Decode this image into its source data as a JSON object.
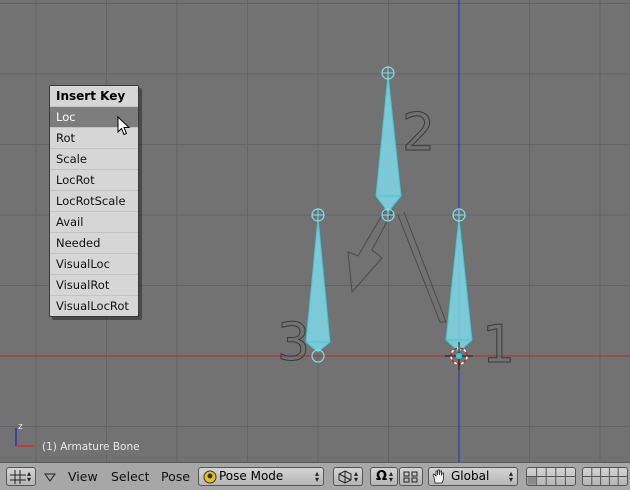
{
  "menu": {
    "title": "Insert Key",
    "items": [
      "Loc",
      "Rot",
      "Scale",
      "LocRot",
      "LocRotScale",
      "Avail",
      "Needed",
      "VisualLoc",
      "VisualRot",
      "VisualLocRot"
    ],
    "active_index": 0
  },
  "viewport": {
    "status": "(1) Armature Bone",
    "axis_label": "z",
    "bone_labels": [
      "1",
      "2",
      "3"
    ]
  },
  "header": {
    "menus": [
      "View",
      "Select",
      "Pose"
    ],
    "mode": "Pose Mode",
    "orientation": "Global"
  },
  "colors": {
    "viewport_bg": "#727272",
    "grid_line": "#646464",
    "bone_fill": "#7fd8e8",
    "bone_stroke": "#3ec8d8",
    "z_axis": "#2a2ad0",
    "x_axis": "#b03030",
    "menu_active": "#7d7d7d"
  },
  "icons": [
    "grid-icon",
    "triangle-down-icon",
    "mode-icon",
    "draw-type-icon",
    "pivot-icon",
    "hand-manipulator-icon",
    "layer-grid-icon",
    "cursor-arrow-icon"
  ]
}
